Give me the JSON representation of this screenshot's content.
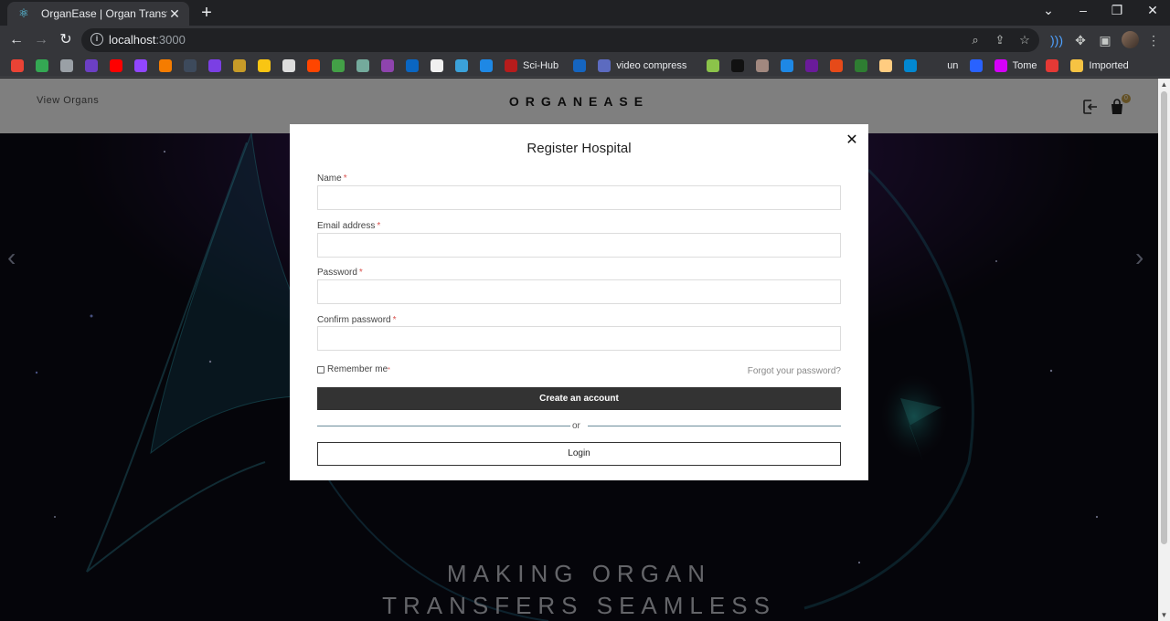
{
  "browser": {
    "tab": {
      "title": "OrganEase | Organ Transfer",
      "favicon": "react-icon",
      "close_glyph": "✕"
    },
    "new_tab_glyph": "+",
    "window_controls": [
      "⌄",
      "–",
      "❐",
      "✕"
    ],
    "nav": {
      "back": "←",
      "forward": "→",
      "reload": "↻"
    },
    "omnibox": {
      "host": "localhost",
      "port": ":3000",
      "info_glyph": "i"
    },
    "bookmarks": [
      {
        "label": "",
        "color": "#ea4335"
      },
      {
        "label": "",
        "color": "#34a853"
      },
      {
        "label": "",
        "color": "#9aa0a6"
      },
      {
        "label": "",
        "color": "#6c3fc4"
      },
      {
        "label": "",
        "color": "#ff0000"
      },
      {
        "label": "",
        "color": "#9146ff"
      },
      {
        "label": "",
        "color": "#f57c00"
      },
      {
        "label": "",
        "color": "#3d4a5c"
      },
      {
        "label": "",
        "color": "#7b3fe4"
      },
      {
        "label": "",
        "color": "#c79b28"
      },
      {
        "label": "",
        "color": "#f9c513"
      },
      {
        "label": "",
        "color": "#dddddd"
      },
      {
        "label": "",
        "color": "#ff4500"
      },
      {
        "label": "",
        "color": "#43a047"
      },
      {
        "label": "",
        "color": "#74aa9c"
      },
      {
        "label": "",
        "color": "#8e44ad"
      },
      {
        "label": "",
        "color": "#0a66c2"
      },
      {
        "label": "",
        "color": "#f0f0f0"
      },
      {
        "label": "",
        "color": "#3ba1d9"
      },
      {
        "label": "",
        "color": "#1e88e5"
      },
      {
        "label": "Sci-Hub",
        "color": "#b71c1c"
      },
      {
        "label": "",
        "color": "#1565c0"
      },
      {
        "label": "video compress",
        "color": "#5c6bc0"
      },
      {
        "label": "",
        "color": "#8bc34a"
      },
      {
        "label": "",
        "color": "#111111"
      },
      {
        "label": "",
        "color": "#a1887f"
      },
      {
        "label": "",
        "color": "#1e88e5"
      },
      {
        "label": "",
        "color": "#6a1b9a"
      },
      {
        "label": "",
        "color": "#e64a19"
      },
      {
        "label": "",
        "color": "#2e7d32"
      },
      {
        "label": "",
        "color": "#ffcc80"
      },
      {
        "label": "",
        "color": "#0288d1"
      },
      {
        "label": "un",
        "color": "#35363a"
      },
      {
        "label": "",
        "color": "#2962ff"
      },
      {
        "label": "Tome",
        "color": "#d500f9"
      },
      {
        "label": "",
        "color": "#e53935"
      },
      {
        "label": "Imported",
        "color": "#f6c343"
      }
    ]
  },
  "site": {
    "nav_link": "View Organs",
    "logo": "ORGANEASE",
    "cart_count": "0",
    "hero_line1": "MAKING ORGAN",
    "hero_line2": "TRANSFERS SEAMLESS"
  },
  "modal": {
    "title": "Register Hospital",
    "close_glyph": "✕",
    "fields": {
      "name": {
        "label": "Name",
        "value": "",
        "placeholder": ""
      },
      "email": {
        "label": "Email address",
        "value": "",
        "placeholder": ""
      },
      "password": {
        "label": "Password",
        "value": "",
        "placeholder": ""
      },
      "confirm_password": {
        "label": "Confirm password",
        "value": "",
        "placeholder": ""
      }
    },
    "required_mark": "*",
    "remember_label": "Remember me",
    "remember_checked": false,
    "forgot_link": "Forgot your password?",
    "primary_button": "Create an account",
    "divider_text": "or",
    "secondary_button": "Login"
  }
}
